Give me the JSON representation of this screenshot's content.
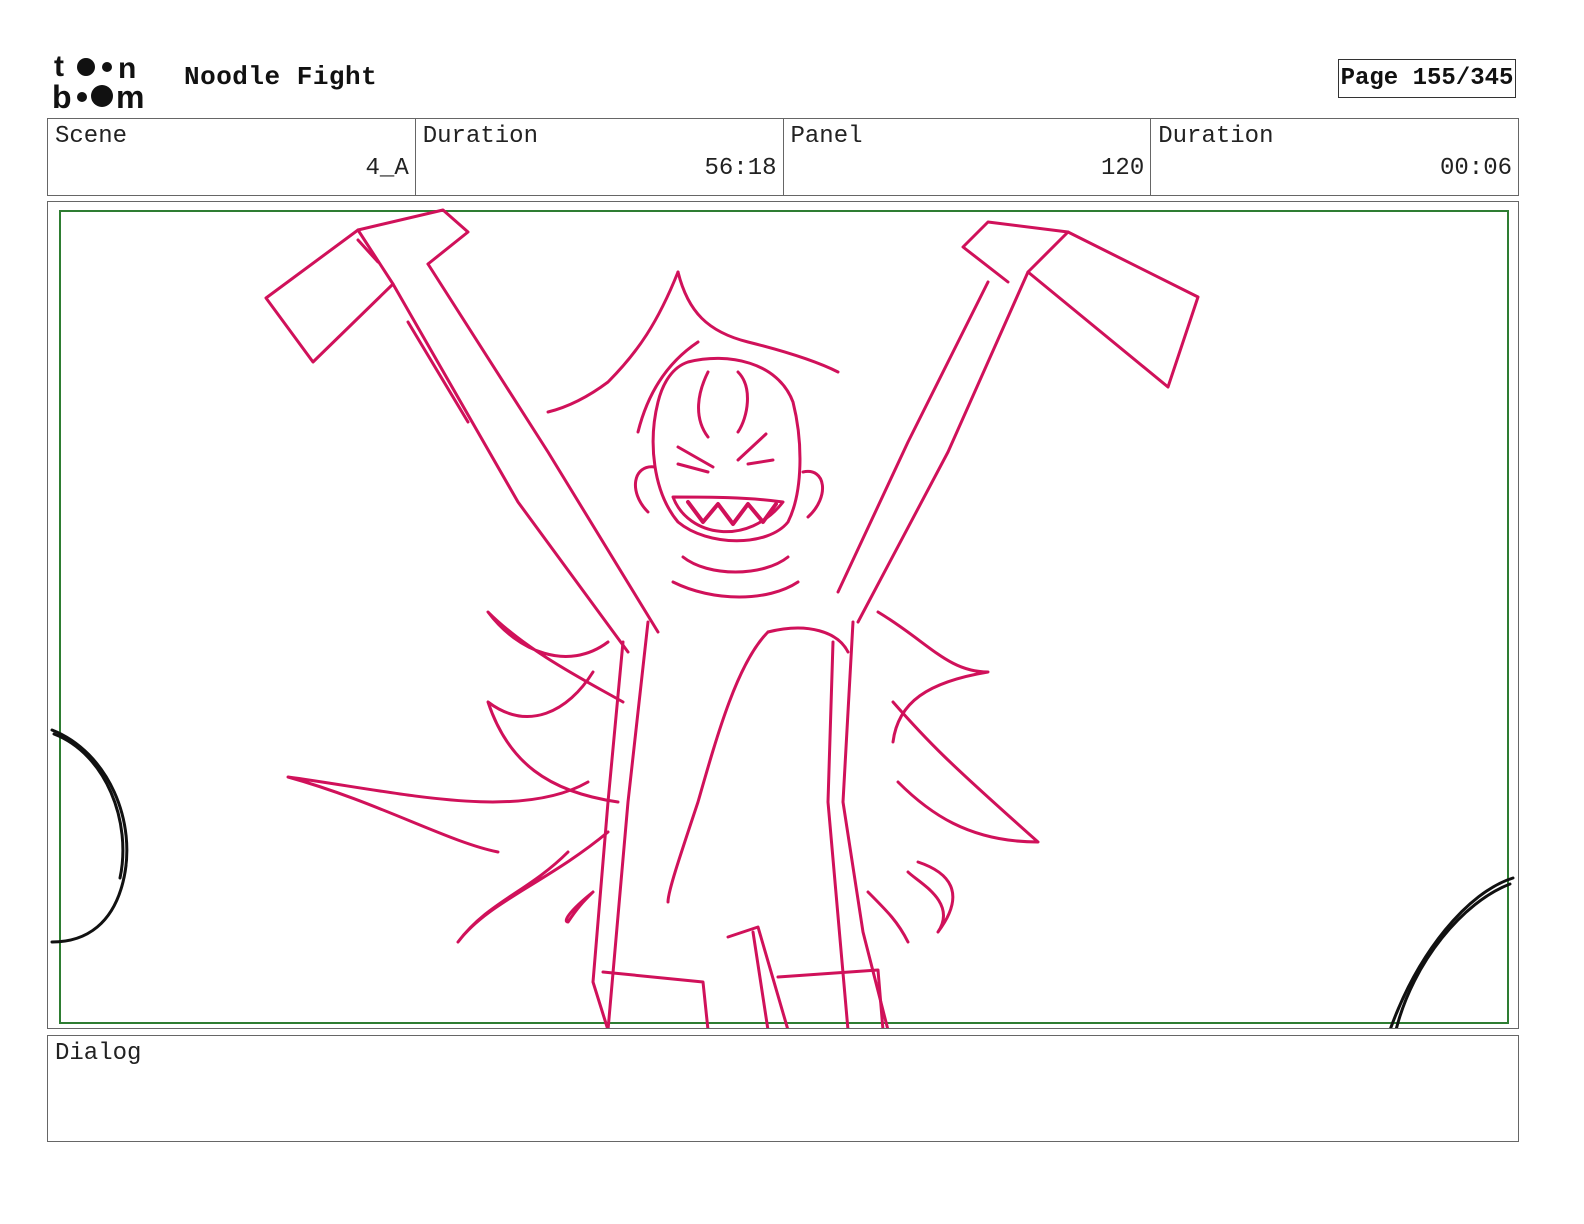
{
  "header": {
    "logo_text_top": "toon",
    "logo_text_bottom": "boom",
    "project_title": "Noodle Fight",
    "page_label": "Page 155/345"
  },
  "info": {
    "scene_label": "Scene",
    "scene_value": "4_A",
    "scene_duration_label": "Duration",
    "scene_duration_value": "56:18",
    "panel_label": "Panel",
    "panel_value": "120",
    "panel_duration_label": "Duration",
    "panel_duration_value": "00:06"
  },
  "drawing": {
    "sketch_color": "#d0115a",
    "frame_color": "#2e7d32",
    "outline_color": "#111111"
  },
  "dialog": {
    "label": "Dialog"
  }
}
